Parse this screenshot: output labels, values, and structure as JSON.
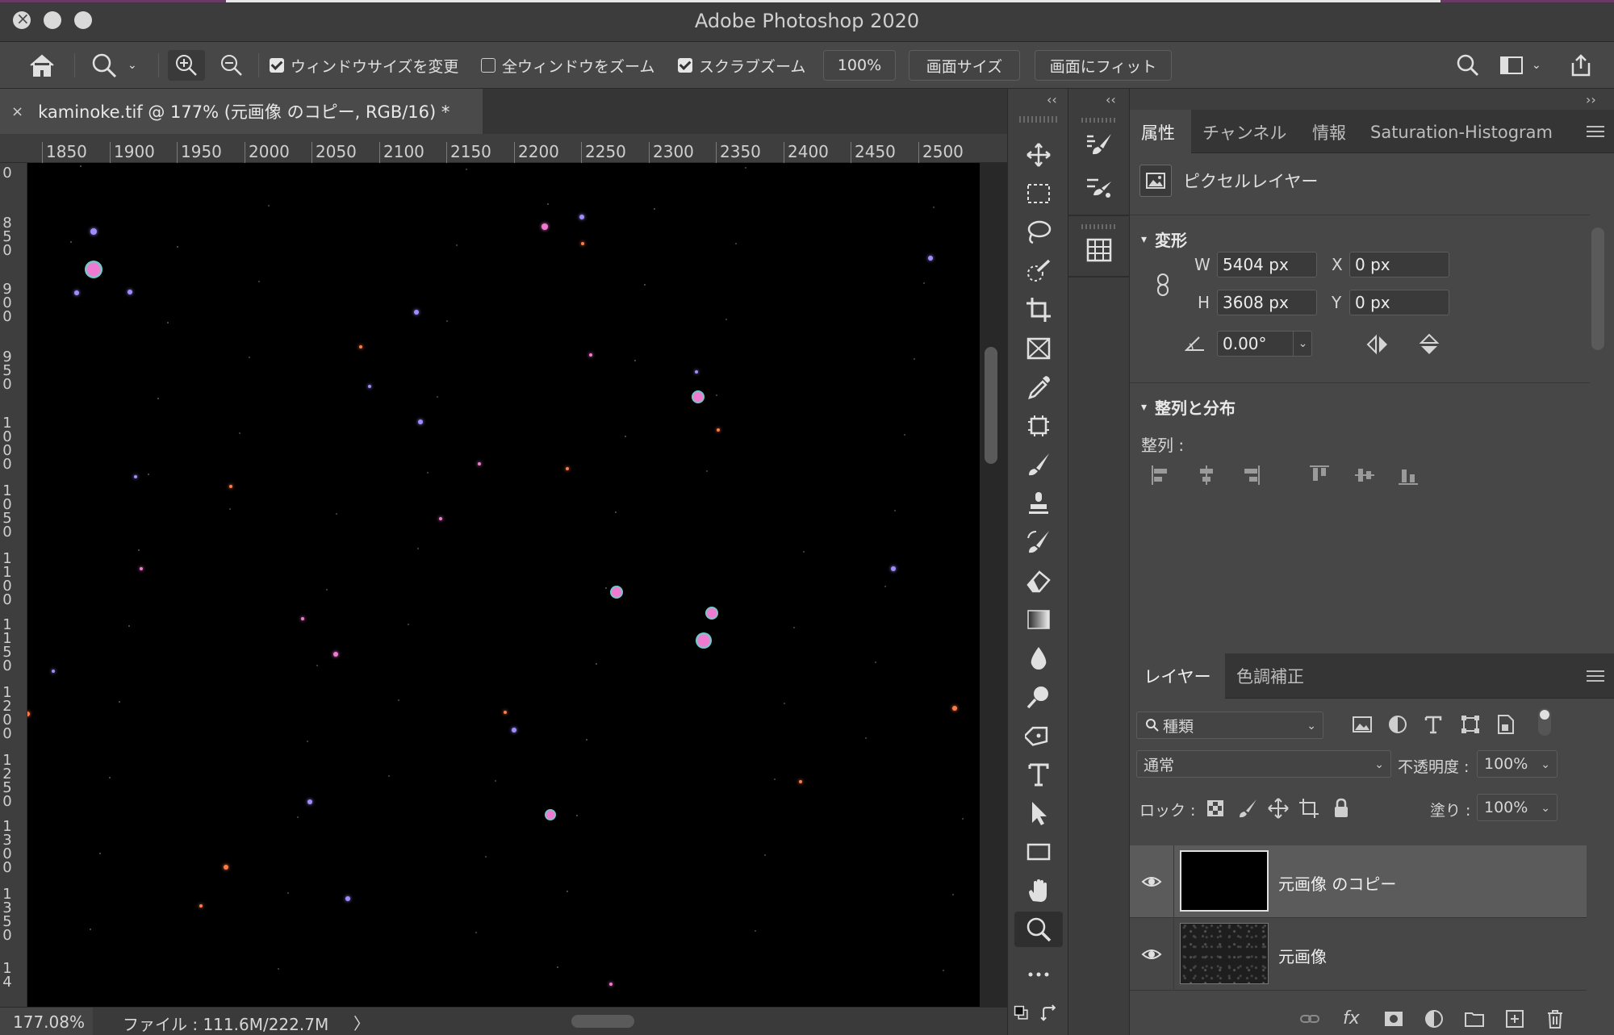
{
  "window": {
    "title": "Adobe Photoshop 2020"
  },
  "options_bar": {
    "resize_windows_label": "ウィンドウサイズを変更",
    "zoom_all_label": "全ウィンドウをズーム",
    "scrubby_zoom_label": "スクラブズーム",
    "zoom_100_label": "100%",
    "fit_screen_label": "画面サイズ",
    "fill_screen_label": "画面にフィット"
  },
  "document": {
    "tab_title": "kaminoke.tif @ 177% (元画像 のコピー, RGB/16) *",
    "close_glyph": "×",
    "ruler_h": [
      "1850",
      "1900",
      "1950",
      "2000",
      "2050",
      "2100",
      "2150",
      "2200",
      "2250",
      "2300",
      "2350",
      "2400",
      "2450",
      "2500"
    ],
    "ruler_v": [
      "0",
      "850",
      "900",
      "950",
      "1000",
      "1050",
      "1100",
      "1150",
      "1200",
      "1250",
      "1300",
      "1350",
      "14"
    ]
  },
  "status": {
    "zoom": "177.08%",
    "file_info": "ファイル : 111.6M/222.7M",
    "arrow": "〉"
  },
  "panels": {
    "collapse_glyph": "‹‹",
    "expand_glyph": "››",
    "top_tabs": [
      "属性",
      "チャンネル",
      "情報",
      "Saturation-Histogram"
    ],
    "properties": {
      "layer_type": "ピクセルレイヤー",
      "transform_title": "変形",
      "w_label": "W",
      "w_value": "5404 px",
      "h_label": "H",
      "h_value": "3608 px",
      "x_label": "X",
      "x_value": "0 px",
      "y_label": "Y",
      "y_value": "0 px",
      "angle_value": "0.00°",
      "align_title": "整列と分布",
      "align_label": "整列 :"
    },
    "layer_tabs": [
      "レイヤー",
      "色調補正"
    ],
    "layers": {
      "filter_kind": "種類",
      "blend_mode": "通常",
      "opacity_label": "不透明度 :",
      "opacity_value": "100%",
      "lock_label": "ロック :",
      "fill_label": "塗り :",
      "fill_value": "100%",
      "items": [
        {
          "name": "元画像 のコピー",
          "selected": true
        },
        {
          "name": "元画像",
          "selected": false
        }
      ]
    }
  },
  "icons": {
    "home": "home-icon",
    "zoom": "zoom-tool-icon",
    "zoom_in": "zoom-in-icon",
    "zoom_out": "zoom-out-icon",
    "search": "search-icon",
    "workspace": "workspace-icon",
    "share": "share-icon"
  },
  "colors": {
    "accent_star_pink": "#f07ad0",
    "accent_star_cyan": "#4fe0c8",
    "accent_star_blue": "#9f8cff",
    "accent_star_orange": "#ff7a4a"
  }
}
